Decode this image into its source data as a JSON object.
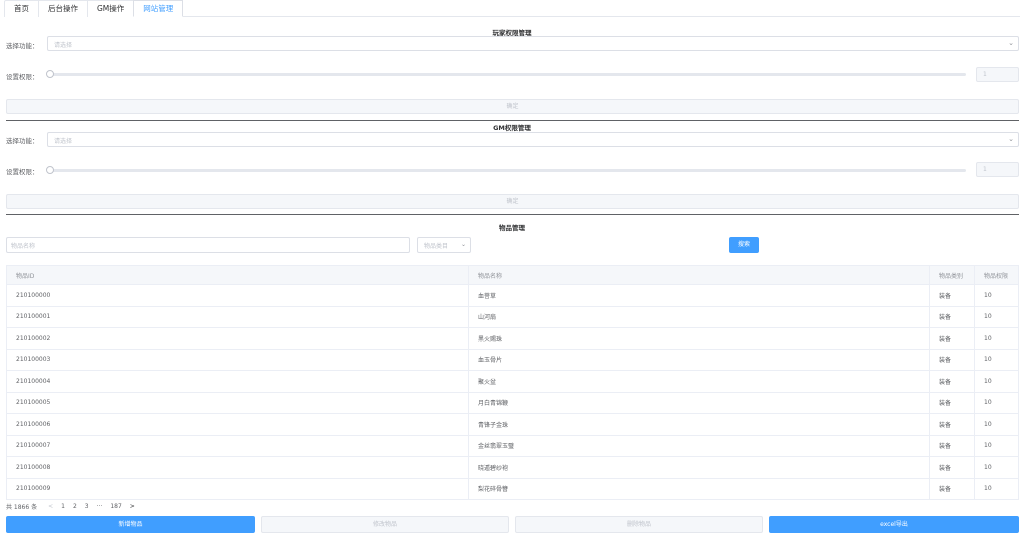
{
  "tabs": [
    {
      "label": "首页"
    },
    {
      "label": "后台操作"
    },
    {
      "label": "GM操作"
    },
    {
      "label": "网站管理"
    }
  ],
  "player_perm": {
    "title": "玩家权限管理",
    "function_label": "选择功能：",
    "function_placeholder": "请选择",
    "perm_label": "设置权限：",
    "perm_value": "1",
    "slider_value": 0,
    "confirm_label": "确定"
  },
  "gm_perm": {
    "title": "GM权限管理",
    "function_label": "选择功能：",
    "function_placeholder": "请选择",
    "perm_label": "设置权限：",
    "perm_value": "1",
    "slider_value": 0,
    "confirm_label": "确定"
  },
  "items": {
    "title": "物品管理",
    "name_placeholder": "物品名称",
    "category_placeholder": "物品类目",
    "search_label": "搜索",
    "columns": [
      "物品ID",
      "物品名称",
      "物品类别",
      "物品权限"
    ],
    "rows": [
      [
        "210100000",
        "血菩草",
        "装备",
        "10"
      ],
      [
        "210100001",
        "山河扇",
        "装备",
        "10"
      ],
      [
        "210100002",
        "黑火赐珠",
        "装备",
        "10"
      ],
      [
        "210100003",
        "血玉骨片",
        "装备",
        "10"
      ],
      [
        "210100004",
        "聚火盆",
        "装备",
        "10"
      ],
      [
        "210100005",
        "月白青锦鞭",
        "装备",
        "10"
      ],
      [
        "210100006",
        "青锋子金珠",
        "装备",
        "10"
      ],
      [
        "210100007",
        "金丝翡翠玉璧",
        "装备",
        "10"
      ],
      [
        "210100008",
        "晓遁碧纱袍",
        "装备",
        "10"
      ],
      [
        "210100009",
        "梨花碎骨簪",
        "装备",
        "10"
      ]
    ]
  },
  "pager": {
    "total": "共 1866 条",
    "prev": "<",
    "pages": [
      "1",
      "2",
      "3",
      "···",
      "187"
    ],
    "next": ">"
  },
  "actions": {
    "add": "新增物品",
    "edit": "修改物品",
    "delete": "删除物品",
    "export": "excel导出"
  },
  "colors": {
    "primary": "#409eff",
    "border": "#dcdfe6",
    "disabled_bg": "#f5f7fa"
  }
}
